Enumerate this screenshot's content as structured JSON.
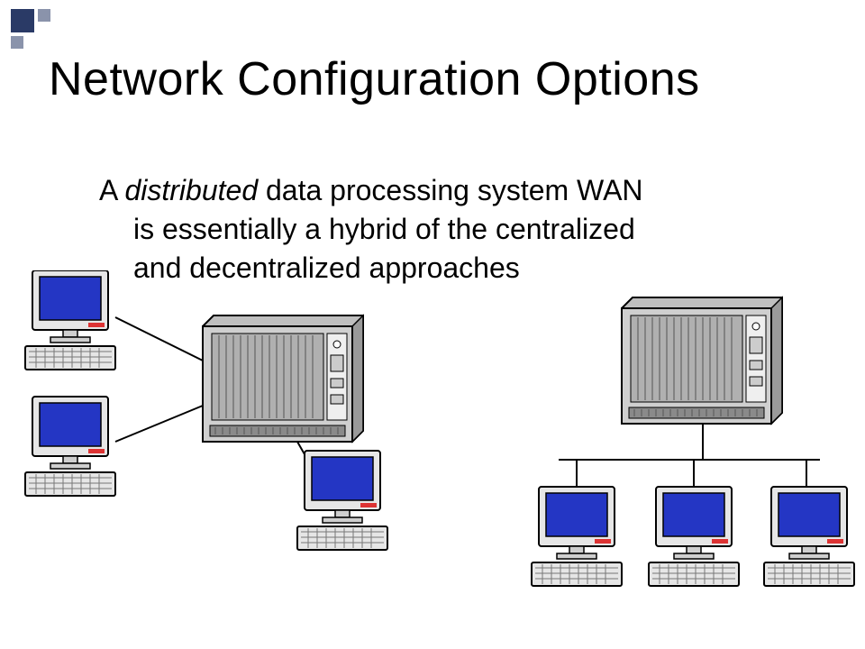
{
  "title": "Network Configuration Options",
  "body": {
    "line1a": "A ",
    "line1_em": "distributed",
    "line1b": " data processing system WAN",
    "line2": "is essentially a hybrid of the centralized",
    "line3": "and decentralized approaches"
  },
  "icons": {
    "server": "server-rack-icon",
    "computer": "desktop-computer-icon"
  }
}
